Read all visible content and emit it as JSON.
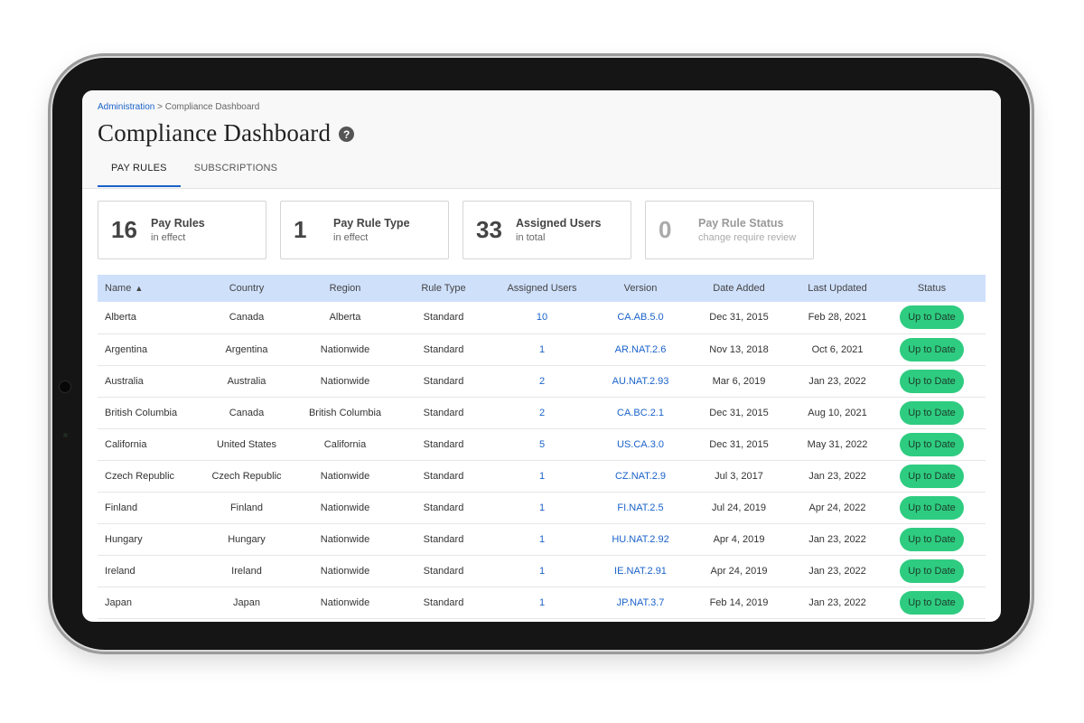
{
  "breadcrumb": {
    "parent": "Administration",
    "separator": ">",
    "current": "Compliance Dashboard"
  },
  "page": {
    "title": "Compliance Dashboard",
    "help_icon": "question-circle-icon"
  },
  "tabs": [
    {
      "label": "PAY RULES",
      "active": true
    },
    {
      "label": "SUBSCRIPTIONS",
      "active": false
    }
  ],
  "cards": [
    {
      "value": "16",
      "label": "Pay Rules",
      "sub": "in effect"
    },
    {
      "value": "1",
      "label": "Pay Rule Type",
      "sub": "in effect"
    },
    {
      "value": "33",
      "label": "Assigned Users",
      "sub": "in total"
    },
    {
      "value": "0",
      "label": "Pay Rule Status",
      "sub": "change require review"
    }
  ],
  "table": {
    "sort_icon": "▲",
    "columns": [
      "Name",
      "Country",
      "Region",
      "Rule Type",
      "Assigned Users",
      "Version",
      "Date Added",
      "Last Updated",
      "Status"
    ],
    "rows": [
      [
        "Alberta",
        "Canada",
        "Alberta",
        "Standard",
        "10",
        "CA.AB.5.0",
        "Dec 31, 2015",
        "Feb 28, 2021",
        "Up to Date"
      ],
      [
        "Argentina",
        "Argentina",
        "Nationwide",
        "Standard",
        "1",
        "AR.NAT.2.6",
        "Nov 13, 2018",
        "Oct 6, 2021",
        "Up to Date"
      ],
      [
        "Australia",
        "Australia",
        "Nationwide",
        "Standard",
        "2",
        "AU.NAT.2.93",
        "Mar 6, 2019",
        "Jan 23, 2022",
        "Up to Date"
      ],
      [
        "British Columbia",
        "Canada",
        "British Columbia",
        "Standard",
        "2",
        "CA.BC.2.1",
        "Dec 31, 2015",
        "Aug 10, 2021",
        "Up to Date"
      ],
      [
        "California",
        "United States",
        "California",
        "Standard",
        "5",
        "US.CA.3.0",
        "Dec 31, 2015",
        "May 31, 2022",
        "Up to Date"
      ],
      [
        "Czech Republic",
        "Czech Republic",
        "Nationwide",
        "Standard",
        "1",
        "CZ.NAT.2.9",
        "Jul 3, 2017",
        "Jan 23, 2022",
        "Up to Date"
      ],
      [
        "Finland",
        "Finland",
        "Nationwide",
        "Standard",
        "1",
        "FI.NAT.2.5",
        "Jul 24, 2019",
        "Apr 24, 2022",
        "Up to Date"
      ],
      [
        "Hungary",
        "Hungary",
        "Nationwide",
        "Standard",
        "1",
        "HU.NAT.2.92",
        "Apr 4, 2019",
        "Jan 23, 2022",
        "Up to Date"
      ],
      [
        "Ireland",
        "Ireland",
        "Nationwide",
        "Standard",
        "1",
        "IE.NAT.2.91",
        "Apr 24, 2019",
        "Jan 23, 2022",
        "Up to Date"
      ],
      [
        "Japan",
        "Japan",
        "Nationwide",
        "Standard",
        "1",
        "JP.NAT.3.7",
        "Feb 14, 2019",
        "Jan 23, 2022",
        "Up to Date"
      ]
    ]
  },
  "colors": {
    "accent": "#1a62c9",
    "status_green": "#2ecc80",
    "table_header": "#cfe0fb"
  }
}
